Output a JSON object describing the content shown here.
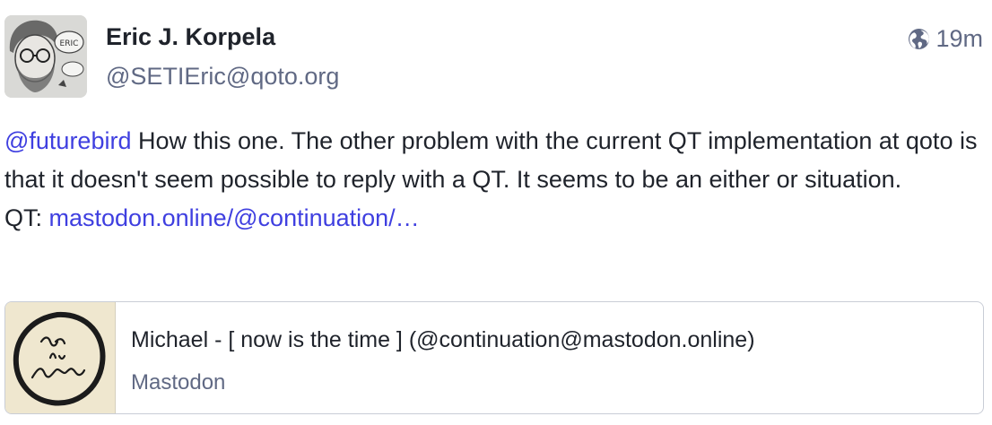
{
  "author": {
    "display_name": "Eric J. Korpela",
    "handle": "@SETIEric@qoto.org"
  },
  "post_meta": {
    "visibility_icon": "globe-icon",
    "timestamp": "19m"
  },
  "content": {
    "mention": "@futurebird",
    "text_line_1": " How this one.  The other problem with the current QT implementation at qoto is that it doesn't seem possible to reply with a QT.  It seems to be an either or situation.",
    "qt_prefix": "QT: ",
    "qt_link": "mastodon.online/@continuation/…"
  },
  "link_card": {
    "title": "Michael - [ now is the time ] (@continuation@mastodon.online)",
    "provider": "Mastodon"
  },
  "colors": {
    "link": "#3f3fe0",
    "muted": "#606984",
    "text": "#1f232b"
  }
}
